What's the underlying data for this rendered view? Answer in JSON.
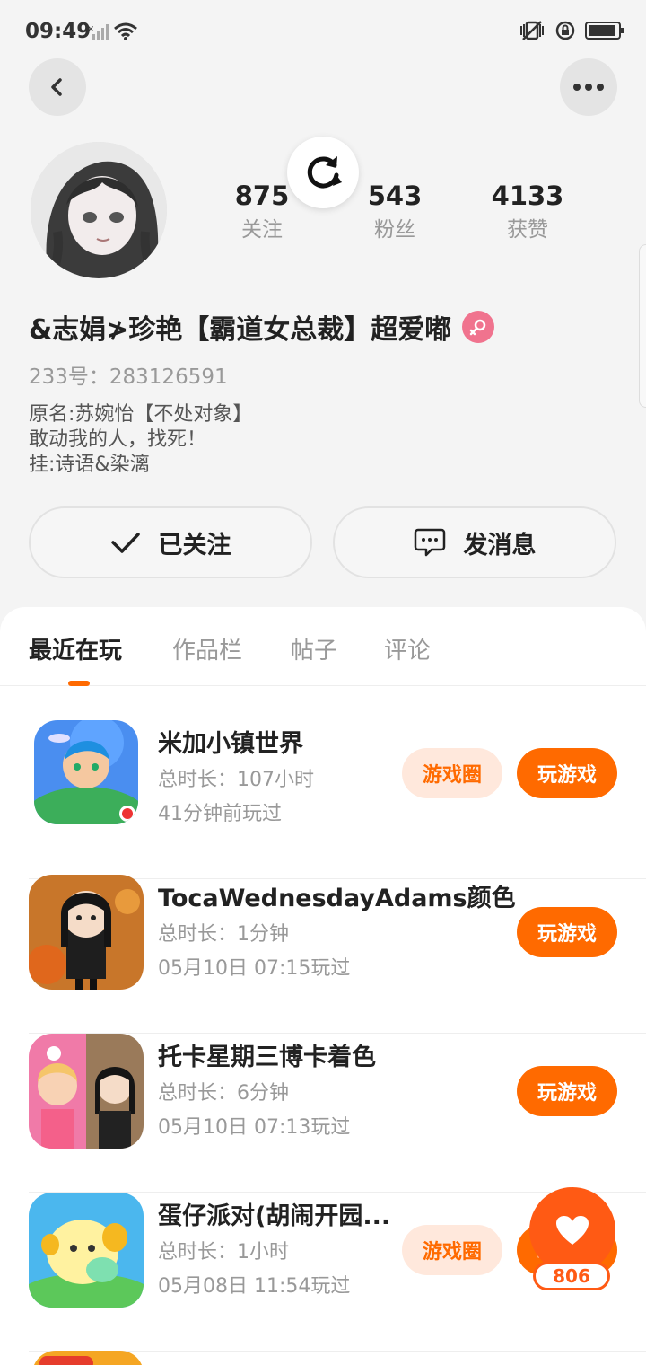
{
  "status_bar": {
    "time": "09:49"
  },
  "profile": {
    "stats": [
      {
        "value": "875",
        "label": "关注"
      },
      {
        "value": "543",
        "label": "粉丝"
      },
      {
        "value": "4133",
        "label": "获赞"
      }
    ],
    "name": "&志娟≯珍艳【霸道女总裁】超爱嘟",
    "uid": "233号：283126591",
    "bio": [
      "原名:苏婉怡【不处对象】",
      "敢动我的人，找死！",
      "挂:诗语&染漓"
    ],
    "follow_label": "已关注",
    "message_label": "发消息"
  },
  "tabs": [
    "最近在玩",
    "作品栏",
    "帖子",
    "评论"
  ],
  "games": [
    {
      "title": "米加小镇世界",
      "duration": "总时长：107小时",
      "last_played": "41分钟前玩过",
      "circle_label": "游戏圈",
      "play_label": "玩游戏"
    },
    {
      "title": "TocaWednesdayAdams颜色",
      "duration": "总时长：1分钟",
      "last_played": "05月10日 07:15玩过",
      "play_label": "玩游戏"
    },
    {
      "title": "托卡星期三博卡着色",
      "duration": "总时长：6分钟",
      "last_played": "05月10日 07:13玩过",
      "play_label": "玩游戏"
    },
    {
      "title": "蛋仔派对(胡闹开园...",
      "duration": "总时长：1小时",
      "last_played": "05月08日 11:54玩过",
      "circle_label": "游戏圈",
      "play_label": "玩游戏"
    }
  ],
  "like_count": "806",
  "colors": {
    "accent": "#ff6a00",
    "accent_light": "#ffe8dc",
    "gender_female": "#f0738e"
  },
  "icons": [
    "back-arrow-icon",
    "more-dots-icon",
    "refresh-icon",
    "female-icon",
    "check-icon",
    "chat-bubble-icon",
    "heart-icon"
  ]
}
